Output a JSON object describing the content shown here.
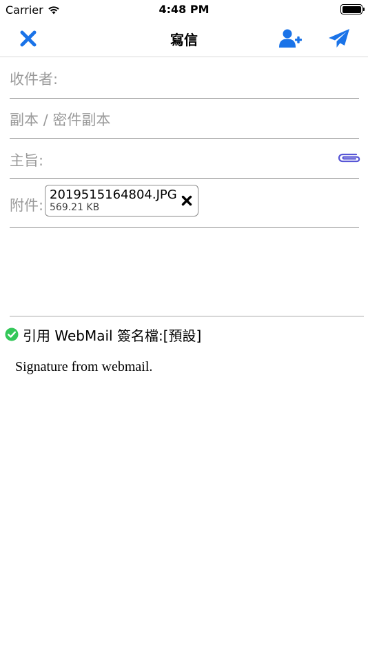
{
  "status_bar": {
    "carrier": "Carrier",
    "time": "4:48 PM"
  },
  "nav": {
    "title": "寫信",
    "accent_color": "#1a73e8"
  },
  "compose": {
    "to_placeholder": "收件者:",
    "cc_placeholder": "副本 / 密件副本",
    "subject_placeholder": "主旨:",
    "attachments_label": "附件:",
    "attachments": [
      {
        "filename": "2019515164804.JPG",
        "size": "569.21 KB"
      }
    ]
  },
  "signature": {
    "option_label": "引用 WebMail 簽名檔:[預設]",
    "checked": true,
    "check_color": "#34c759",
    "text": "Signature from webmail."
  }
}
